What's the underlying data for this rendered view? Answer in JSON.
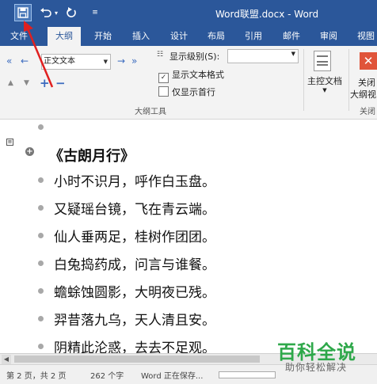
{
  "title_bar": {
    "title": "Word联盟.docx - Word",
    "customize_glyph": "≡"
  },
  "tabs": [
    {
      "label": "文件",
      "name": "tab-file"
    },
    {
      "label": "大纲",
      "name": "tab-outline",
      "active": true
    },
    {
      "label": "开始",
      "name": "tab-home"
    },
    {
      "label": "插入",
      "name": "tab-insert"
    },
    {
      "label": "设计",
      "name": "tab-design"
    },
    {
      "label": "布局",
      "name": "tab-layout"
    },
    {
      "label": "引用",
      "name": "tab-references"
    },
    {
      "label": "邮件",
      "name": "tab-mailings"
    },
    {
      "label": "审阅",
      "name": "tab-review"
    },
    {
      "label": "视图",
      "name": "tab-view"
    }
  ],
  "ribbon": {
    "outline_level_value": "正文文本",
    "show_level_label": "显示级别(S):",
    "show_text_format_label": "显示文本格式",
    "show_text_format_checked": true,
    "show_first_line_label": "仅显示首行",
    "show_first_line_checked": false,
    "group_outline_tools": "大纲工具",
    "master_document_label": "主控文档",
    "close_outline_label_line1": "关闭",
    "close_outline_label_line2": "大纲视",
    "close_group_label": "关闭"
  },
  "document": {
    "heading": "《古朗月行》",
    "lines": [
      "小时不识月，呼作白玉盘。",
      "又疑瑶台镜，飞在青云端。",
      "仙人垂两足，桂树作团团。",
      "白兔捣药成，问言与谁餐。",
      "蟾蜍蚀圆影，大明夜已残。",
      "羿昔落九乌，天人清且安。",
      "阴精此沦惑，去去不足观。"
    ]
  },
  "status": {
    "page": "第 2 页，共 2 页",
    "words": "262 个字",
    "saving": "Word 正在保存..."
  },
  "watermark": {
    "main": "百科全说",
    "sub": "助你轻松解决"
  },
  "colors": {
    "ribbon_blue": "#2b579a",
    "annotation_red": "#e02020",
    "watermark_green": "#2ea84a"
  }
}
